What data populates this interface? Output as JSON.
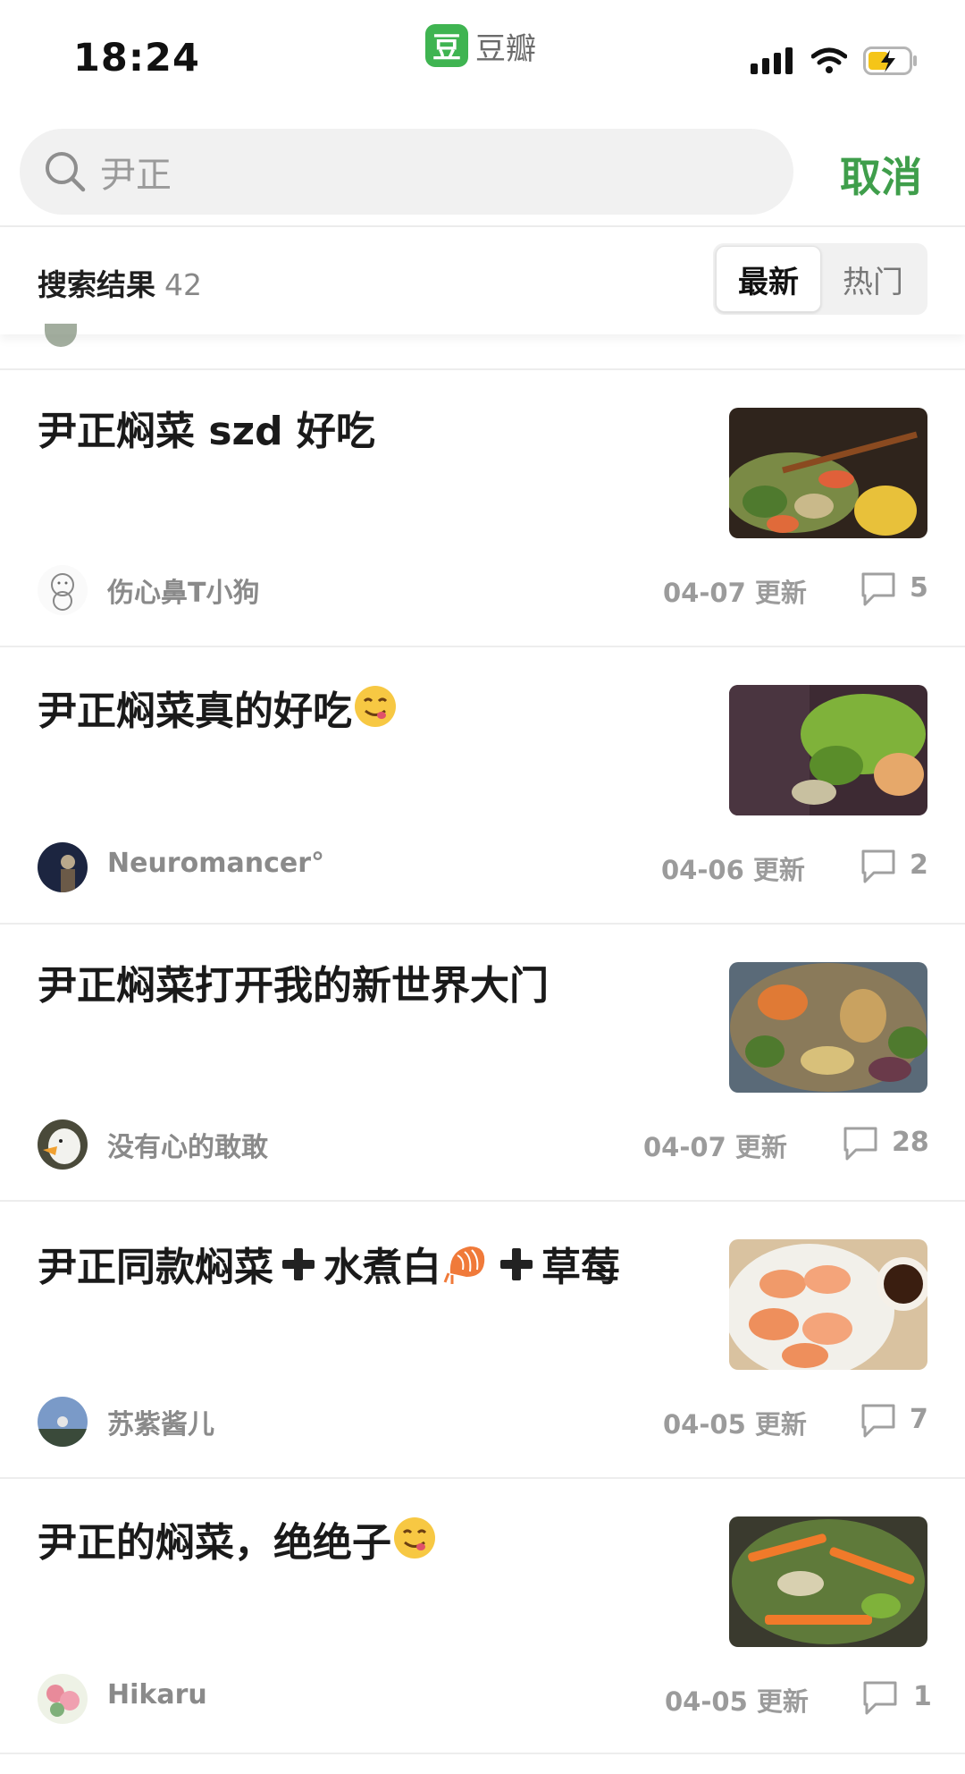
{
  "status_bar": {
    "time": "18:24",
    "app_name": "豆瓣",
    "app_logo_char": "豆",
    "icons": [
      "signal-icon",
      "wifi-icon",
      "battery-charging-icon"
    ]
  },
  "search": {
    "value": "尹正",
    "cancel_label": "取消"
  },
  "results": {
    "label": "搜索结果",
    "count": "42",
    "sort_options": [
      "最新",
      "热门"
    ],
    "active_sort": "最新"
  },
  "items": [
    {
      "title": "尹正焖菜 szd 好吃",
      "author": "伤心鼻T小狗",
      "date": "04-07 更新",
      "comments": "5"
    },
    {
      "title": "尹正焖菜真的好吃",
      "author": "Neuromancer°",
      "date": "04-06 更新",
      "comments": "2"
    },
    {
      "title": "尹正焖菜打开我的新世界大门",
      "author": "没有心的敢敢",
      "date": "04-07 更新",
      "comments": "28"
    },
    {
      "title_part1": "尹正同款焖菜",
      "title_part2": "水煮白",
      "title_part3": "草莓",
      "author": "苏紫酱儿",
      "date": "04-05 更新",
      "comments": "7"
    },
    {
      "title": "尹正的焖菜，绝绝子",
      "author": "Hikaru",
      "date": "04-05 更新",
      "comments": "1"
    }
  ],
  "colors": {
    "accent": "#3f9e4b",
    "logo": "#3fb451"
  }
}
